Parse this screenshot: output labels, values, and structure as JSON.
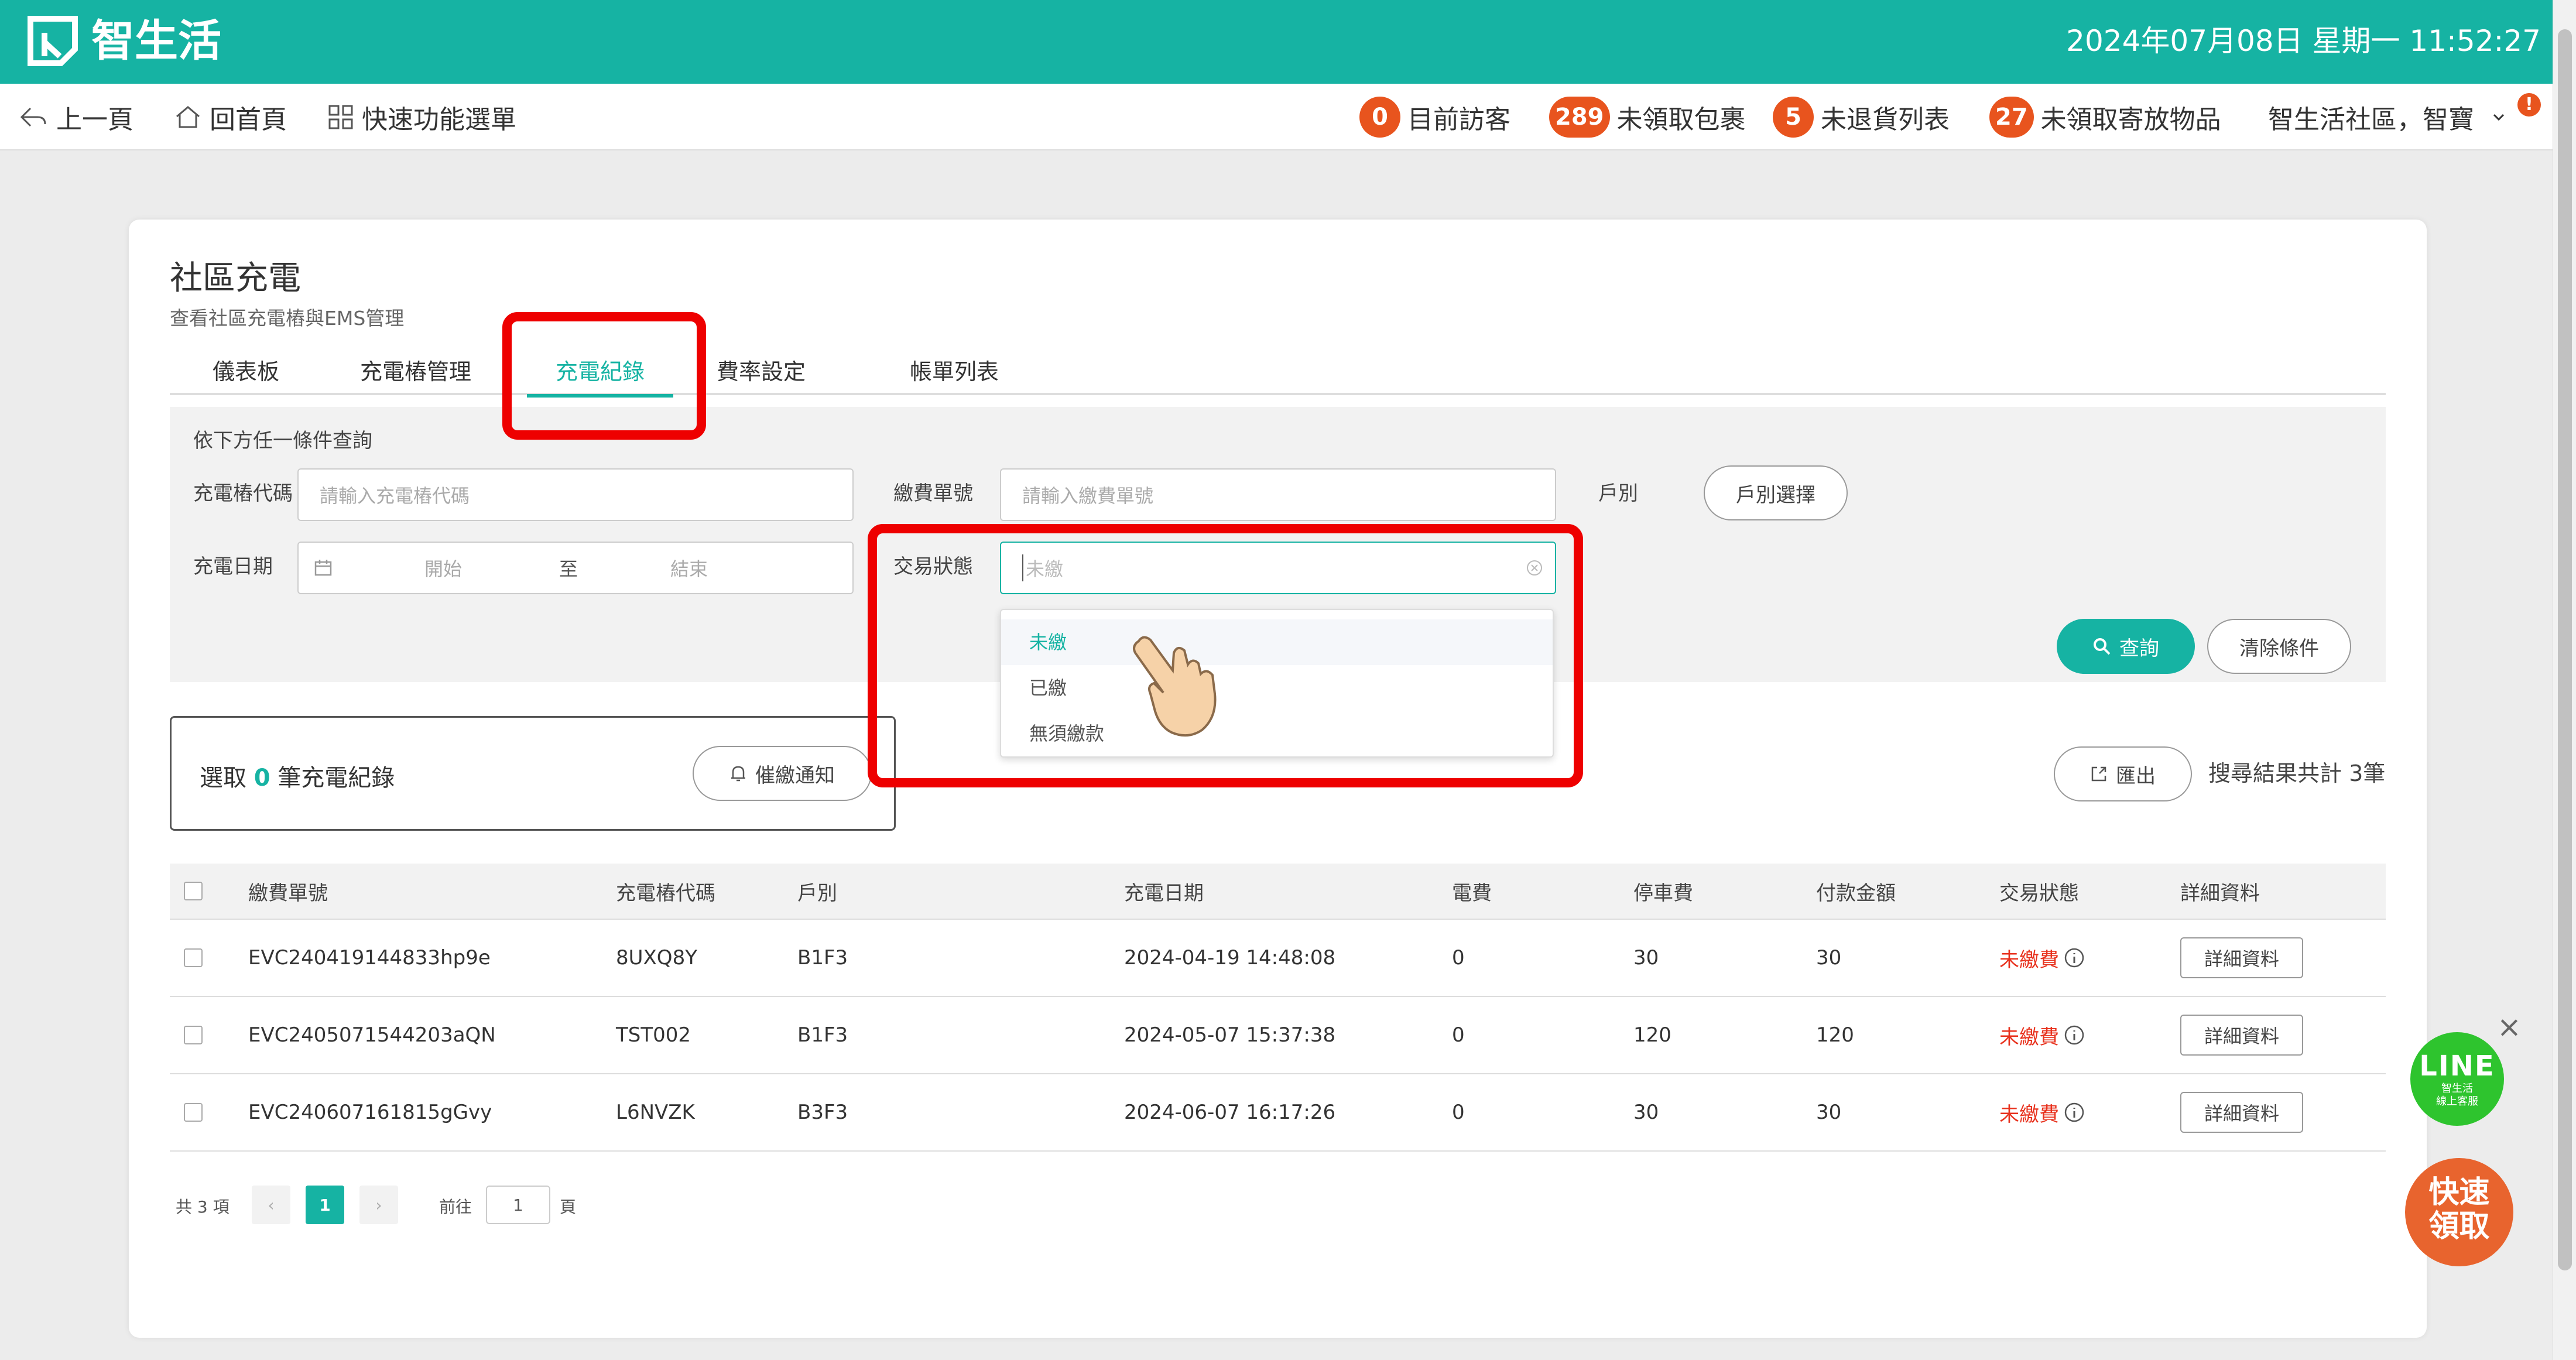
{
  "header": {
    "brand": "智生活",
    "datetime": "2024年07月08日 星期一 11:52:27"
  },
  "nav": {
    "back": "上一頁",
    "home": "回首頁",
    "quick_menu": "快速功能選單",
    "visitors": {
      "count": "0",
      "label": "目前訪客"
    },
    "packages": {
      "count": "289",
      "label": "未領取包裹"
    },
    "returns": {
      "count": "5",
      "label": "未退貨列表"
    },
    "stored": {
      "count": "27",
      "label": "未領取寄放物品"
    },
    "community_user": "智生活社區，智寶",
    "alert": "!"
  },
  "page": {
    "title": "社區充電",
    "subtitle": "查看社區充電樁與EMS管理",
    "tabs": [
      "儀表板",
      "充電樁管理",
      "充電紀錄",
      "費率設定",
      "帳單列表"
    ],
    "active_tab": 2
  },
  "filter": {
    "heading": "依下方任一條件查詢",
    "charger_code_label": "充電樁代碼",
    "charger_code_placeholder": "請輸入充電樁代碼",
    "bill_no_label": "繳費單號",
    "bill_no_placeholder": "請輸入繳費單號",
    "household_label": "戶別",
    "household_button": "戶別選擇",
    "date_label": "充電日期",
    "date_start": "開始",
    "date_to": "至",
    "date_end": "結束",
    "status_label": "交易狀態",
    "status_placeholder": "未繳",
    "status_options": [
      "未繳",
      "已繳",
      "無須繳款"
    ],
    "search_button": "查詢",
    "clear_button": "清除條件"
  },
  "selection": {
    "prefix": "選取",
    "count": "0",
    "suffix": "筆充電紀錄",
    "notify_button": "催繳通知"
  },
  "export_button": "匯出",
  "result_count": "搜尋結果共計 3筆",
  "table": {
    "columns": [
      "繳費單號",
      "充電樁代碼",
      "戶別",
      "充電日期",
      "電費",
      "停車費",
      "付款金額",
      "交易狀態",
      "詳細資料"
    ],
    "rows": [
      {
        "bill_no": "EVC240419144833hp9e",
        "charger": "8UXQ8Y",
        "household": "B1F3",
        "date": "2024-04-19 14:48:08",
        "electricity": "0",
        "parking": "30",
        "amount": "30",
        "status": "未繳費",
        "detail": "詳細資料"
      },
      {
        "bill_no": "EVC2405071544203aQN",
        "charger": "TST002",
        "household": "B1F3",
        "date": "2024-05-07 15:37:38",
        "electricity": "0",
        "parking": "120",
        "amount": "120",
        "status": "未繳費",
        "detail": "詳細資料"
      },
      {
        "bill_no": "EVC240607161815gGvy",
        "charger": "L6NVZK",
        "household": "B3F3",
        "date": "2024-06-07 16:17:26",
        "electricity": "0",
        "parking": "30",
        "amount": "30",
        "status": "未繳費",
        "detail": "詳細資料"
      }
    ]
  },
  "pagination": {
    "total": "共 3 項",
    "prev": "‹",
    "current": "1",
    "next": "›",
    "goto_prefix": "前往",
    "goto_value": "1",
    "goto_suffix": "頁"
  },
  "floating": {
    "line_label": "LINE",
    "line_sub1": "智生活",
    "line_sub2": "線上客服",
    "close": "×",
    "quick_line1": "快速",
    "quick_line2": "領取"
  },
  "colors": {
    "brand": "#16b3a3",
    "badge": "#e8541e",
    "status_unpaid": "#e8321e",
    "annotation": "#ee0000"
  }
}
